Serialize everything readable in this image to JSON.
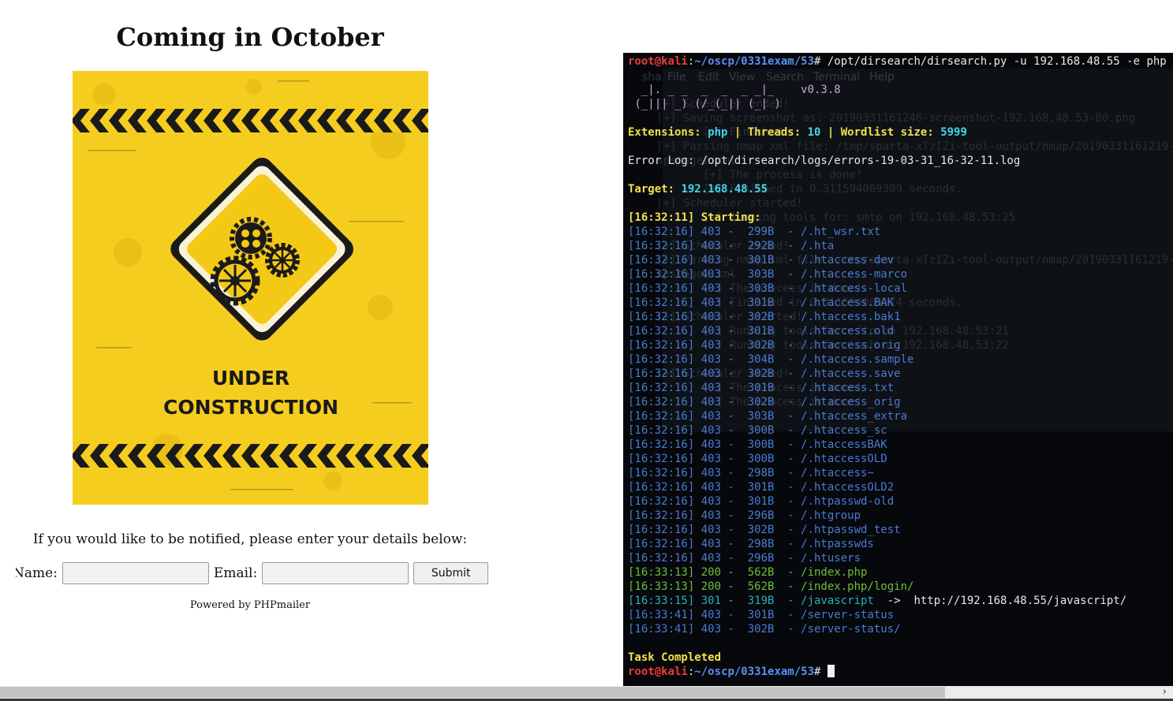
{
  "page": {
    "title": "Coming in October",
    "sign_text_line1": "UNDER",
    "sign_text_line2": "CONSTRUCTION",
    "notify_text": "If you would like to be notified, please enter your details below:",
    "name_label": "Name:",
    "email_label": "Email:",
    "submit_label": "Submit",
    "powered_by": "Powered by PHPmailer"
  },
  "terminal": {
    "menu": [
      "File",
      "Edit",
      "View",
      "Search",
      "Terminal",
      "Help"
    ],
    "menu_prefix": "sha",
    "prompt_user": "root@kali",
    "prompt_path": "~/oscp/0331exam/53",
    "command": "/opt/dirsearch/dirsearch.py -u 192.168.48.55 -e php",
    "logo_line1": "  _|. _ _  _  _  _ _|_    v0.3.8",
    "logo_line2": " (_||| _) (/_(_|| (_| )",
    "extensions_label": "Extensions: ",
    "extensions_value": "php",
    "threads_label": " | Threads: ",
    "threads_value": "10",
    "wordlist_label": " | Wordlist size: ",
    "wordlist_value": "5999",
    "error_log": "Error Log: /opt/dirsearch/logs/errors-19-03-31_16-32-11.log",
    "target_label": "Target: ",
    "target_value": "192.168.48.55",
    "starting": "[16:32:11] Starting: ",
    "results": [
      {
        "text": "[16:32:16] 403 -  299B  - /.ht_wsr.txt",
        "status": "403"
      },
      {
        "text": "[16:32:16] 403 -  292B  - /.hta",
        "status": "403"
      },
      {
        "text": "[16:32:16] 403 -  301B  - /.htaccess-dev",
        "status": "403"
      },
      {
        "text": "[16:32:16] 403 -  303B  - /.htaccess-marco",
        "status": "403"
      },
      {
        "text": "[16:32:16] 403 -  303B  - /.htaccess-local",
        "status": "403"
      },
      {
        "text": "[16:32:16] 403 -  301B  - /.htaccess.BAK",
        "status": "403"
      },
      {
        "text": "[16:32:16] 403 -  302B  - /.htaccess.bak1",
        "status": "403"
      },
      {
        "text": "[16:32:16] 403 -  301B  - /.htaccess.old",
        "status": "403"
      },
      {
        "text": "[16:32:16] 403 -  302B  - /.htaccess.orig",
        "status": "403"
      },
      {
        "text": "[16:32:16] 403 -  304B  - /.htaccess.sample",
        "status": "403"
      },
      {
        "text": "[16:32:16] 403 -  302B  - /.htaccess.save",
        "status": "403"
      },
      {
        "text": "[16:32:16] 403 -  301B  - /.htaccess.txt",
        "status": "403"
      },
      {
        "text": "[16:32:16] 403 -  302B  - /.htaccess_orig",
        "status": "403"
      },
      {
        "text": "[16:32:16] 403 -  303B  - /.htaccess_extra",
        "status": "403"
      },
      {
        "text": "[16:32:16] 403 -  300B  - /.htaccess_sc",
        "status": "403"
      },
      {
        "text": "[16:32:16] 403 -  300B  - /.htaccessBAK",
        "status": "403"
      },
      {
        "text": "[16:32:16] 403 -  300B  - /.htaccessOLD",
        "status": "403"
      },
      {
        "text": "[16:32:16] 403 -  298B  - /.htaccess~",
        "status": "403"
      },
      {
        "text": "[16:32:16] 403 -  301B  - /.htaccessOLD2",
        "status": "403"
      },
      {
        "text": "[16:32:16] 403 -  301B  - /.htpasswd-old",
        "status": "403"
      },
      {
        "text": "[16:32:16] 403 -  296B  - /.htgroup",
        "status": "403"
      },
      {
        "text": "[16:32:16] 403 -  302B  - /.htpasswd_test",
        "status": "403"
      },
      {
        "text": "[16:32:16] 403 -  298B  - /.htpasswds",
        "status": "403"
      },
      {
        "text": "[16:32:16] 403 -  296B  - /.htusers",
        "status": "403"
      },
      {
        "text": "[16:33:13] 200 -  562B  - /index.php",
        "status": "200"
      },
      {
        "text": "[16:33:13] 200 -  562B  - /index.php/login/",
        "status": "200"
      },
      {
        "text": "[16:33:15] 301 -  319B  - /javascript  ",
        "status": "301",
        "redirect": "->  http://192.168.48.55/javascript/"
      },
      {
        "text": "[16:33:41] 403 -  301B  - /server-status",
        "status": "403"
      },
      {
        "text": "[16:33:41] 403 -  302B  - /server-status/",
        "status": "403"
      }
    ],
    "task_completed": "Task Completed",
    "ghost_lines": [
      {
        "row": 3,
        "text": "     [+] Scheduler ended!"
      },
      {
        "row": 4,
        "text": "     [+] Saving screenshot as: 20190331161246-screenshot-192.168.48.53-80.png"
      },
      {
        "row": 5,
        "text": "            [+] Finished"
      },
      {
        "row": 6,
        "text": "     [+] Parsing nmap xml file: /tmp/sparta-xTzIZi-tool-output/nmap/20190331161219-"
      },
      {
        "row": 7,
        "text": "     apstage2.xml"
      },
      {
        "row": 8,
        "text": "            [+] The process is done!"
      },
      {
        "row": 9,
        "text": "            [+] Finished in 0.311594009399 seconds."
      },
      {
        "row": 10,
        "text": "     [+] Scheduler started!"
      },
      {
        "row": 11,
        "text": "            [+] Running tools for: smtp on 192.168.48.53:25"
      },
      {
        "row": 13,
        "text": "     [+] Scheduler ended!"
      },
      {
        "row": 14,
        "text": "     [+] Parsing nmap xml file: /tmp/sparta-xTzIZi-tool-output/nmap/20190331161219-"
      },
      {
        "row": 15,
        "text": "     apstage2.xml"
      },
      {
        "row": 16,
        "text": "            [+] The process is done!"
      },
      {
        "row": 17,
        "text": "            [+] Finished in 0.311594009174 seconds."
      },
      {
        "row": 18,
        "text": "     [+] Scheduler started!"
      },
      {
        "row": 19,
        "text": "            [+] Running tools for: ftp on 192.168.48.53:21"
      },
      {
        "row": 20,
        "text": "            [+] Running tools for: ssh on 192.168.48.53:22"
      },
      {
        "row": 22,
        "text": "     [+] Scheduler ended!"
      },
      {
        "row": 23,
        "text": "            [+] The process is done!"
      },
      {
        "row": 24,
        "text": "            [+] The process is done!"
      }
    ]
  },
  "colors": {
    "hero_yellow": "#f5cd1f",
    "terminal_bg": "#06080c",
    "prompt_red": "#ee3b3b",
    "prompt_blue": "#5c8ff0",
    "status_403": "#4a7bd1",
    "status_200": "#6fbf3a",
    "status_301": "#2ab0b8"
  }
}
